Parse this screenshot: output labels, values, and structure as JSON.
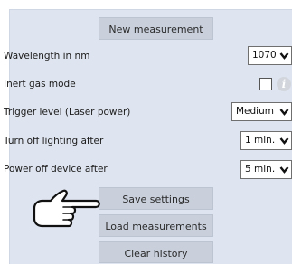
{
  "buttons": {
    "new_measurement": "New measurement",
    "save_settings": "Save settings",
    "load_measurements": "Load measurements",
    "clear_history": "Clear history"
  },
  "settings": {
    "wavelength": {
      "label": "Wavelength in nm",
      "value": "1070"
    },
    "inert_gas": {
      "label": "Inert gas mode",
      "checked": false
    },
    "trigger_level": {
      "label": "Trigger level (Laser power)",
      "value": "Medium"
    },
    "lighting_off": {
      "label": "Turn off lighting after",
      "value": "1 min."
    },
    "power_off": {
      "label": "Power off device after",
      "value": "5 min."
    }
  },
  "icons": {
    "dropdown": "chevron-down-icon",
    "info": "info-icon",
    "pointer": "pointing-hand-icon"
  },
  "colors": {
    "panel_bg": "#dfe5f0",
    "button_bg": "#c9d0dc"
  }
}
